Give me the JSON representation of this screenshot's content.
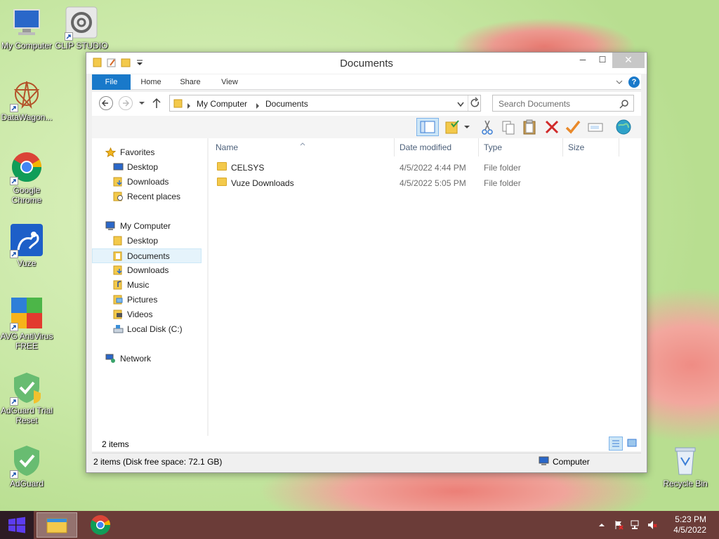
{
  "desktop": {
    "icons": [
      {
        "label": "My Computer"
      },
      {
        "label": "CLIP STUDIO"
      },
      {
        "label": "DataWagon..."
      },
      {
        "label": "Google Chrome"
      },
      {
        "label": "Vuze"
      },
      {
        "label": "AVG AntiVirus FREE"
      },
      {
        "label": "AdGuard Trial Reset"
      },
      {
        "label": "AdGuard"
      },
      {
        "label": "Recycle Bin"
      }
    ]
  },
  "window": {
    "title": "Documents",
    "minimize": "─",
    "maximize": "☐",
    "close": "✕",
    "ribbon_tabs": [
      "File",
      "Home",
      "Share",
      "View"
    ],
    "breadcrumb": [
      "My Computer",
      "Documents"
    ],
    "search_placeholder": "Search Documents",
    "columns": [
      "Name",
      "Date modified",
      "Type",
      "Size"
    ],
    "files": [
      {
        "name": "CELSYS",
        "date": "4/5/2022 4:44 PM",
        "type": "File folder",
        "size": ""
      },
      {
        "name": "Vuze Downloads",
        "date": "4/5/2022 5:05 PM",
        "type": "File folder",
        "size": ""
      }
    ],
    "nav": {
      "favorites_label": "Favorites",
      "favorites": [
        "Desktop",
        "Downloads",
        "Recent places"
      ],
      "computer_label": "My Computer",
      "computer": [
        "Desktop",
        "Documents",
        "Downloads",
        "Music",
        "Pictures",
        "Videos",
        "Local Disk (C:)"
      ],
      "network_label": "Network",
      "selected": "Documents"
    },
    "item_count": "2 items",
    "status_left": "2 items (Disk free space: 72.1 GB)",
    "status_right": "Computer"
  },
  "taskbar": {
    "time": "5:23 PM",
    "date": "4/5/2022"
  },
  "colors": {
    "accent": "#1979ca",
    "taskbar": "#6b3c38",
    "folder": "#f3c94b"
  }
}
